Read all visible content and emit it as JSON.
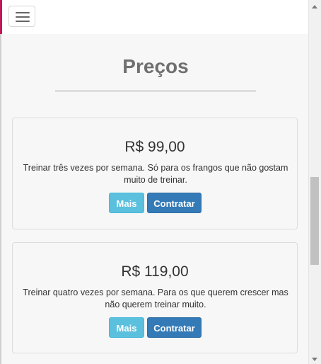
{
  "navbar": {
    "menu_toggle_icon": "hamburger-menu-icon"
  },
  "pricing": {
    "title": "Preços",
    "plans": [
      {
        "price": "R$ 99,00",
        "description": "Treinar três vezes por semana. Só para os frangos que não gostam muito de treinar.",
        "more_label": "Mais",
        "hire_label": "Contratar"
      },
      {
        "price": "R$ 119,00",
        "description": "Treinar quatro vezes por semana. Para os que querem crescer mas não querem treinar muito.",
        "more_label": "Mais",
        "hire_label": "Contratar"
      }
    ]
  },
  "colors": {
    "info_button": "#5bc0de",
    "primary_button": "#337ab7",
    "title": "#6f6f6f",
    "background": "#f7f7f7"
  }
}
